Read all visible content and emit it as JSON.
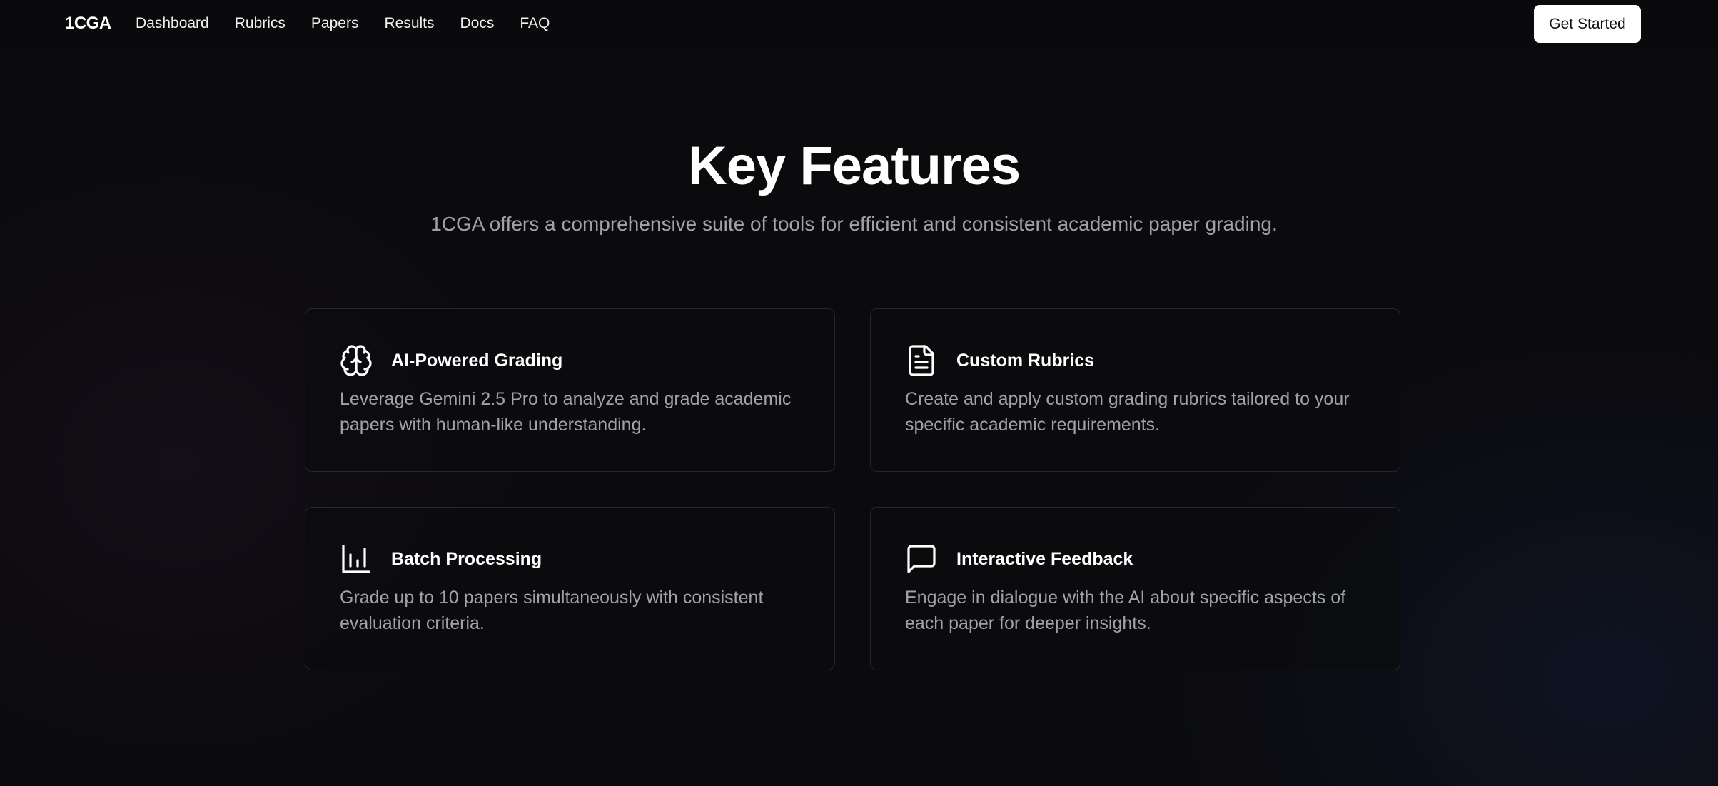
{
  "nav": {
    "brand": "1CGA",
    "links": [
      "Dashboard",
      "Rubrics",
      "Papers",
      "Results",
      "Docs",
      "FAQ"
    ],
    "cta_label": "Get Started"
  },
  "hero": {
    "title": "Key Features",
    "subtitle": "1CGA offers a comprehensive suite of tools for efficient and consistent academic paper grading."
  },
  "features": [
    {
      "icon": "brain-icon",
      "title": "AI-Powered Grading",
      "description": "Leverage Gemini 2.5 Pro to analyze and grade academic papers with human-like understanding."
    },
    {
      "icon": "document-icon",
      "title": "Custom Rubrics",
      "description": "Create and apply custom grading rubrics tailored to your specific academic requirements."
    },
    {
      "icon": "bar-chart-icon",
      "title": "Batch Processing",
      "description": "Grade up to 10 papers simultaneously with consistent evaluation criteria."
    },
    {
      "icon": "message-square-icon",
      "title": "Interactive Feedback",
      "description": "Engage in dialogue with the AI about specific aspects of each paper for deeper insights."
    }
  ],
  "colors": {
    "background": "#0b0b0d",
    "text": "#ffffff",
    "muted": "#a1a1aa",
    "card_border": "#26262b",
    "button_bg": "#ffffff",
    "button_text": "#111111"
  }
}
